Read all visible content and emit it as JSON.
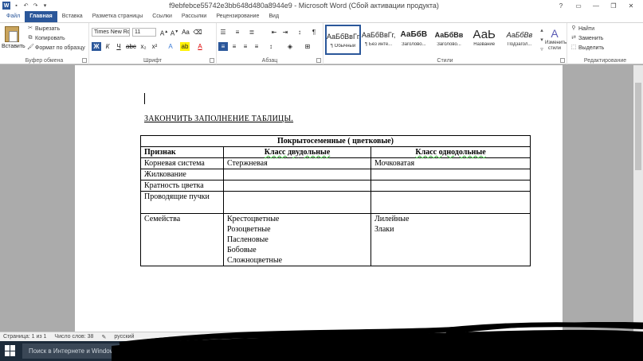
{
  "window": {
    "title": "f9ebfebce55742e3bb648d480a8944e9 - Microsoft Word (Сбой активации продукта)",
    "app_icon": "W"
  },
  "tabs": [
    {
      "label": "Файл"
    },
    {
      "label": "Главная",
      "active": true
    },
    {
      "label": "Вставка"
    },
    {
      "label": "Разметка страницы"
    },
    {
      "label": "Ссылки"
    },
    {
      "label": "Рассылки"
    },
    {
      "label": "Рецензирование"
    },
    {
      "label": "Вид"
    }
  ],
  "ribbon": {
    "clipboard": {
      "paste": "Вставить",
      "cut": "Вырезать",
      "copy": "Копировать",
      "format_painter": "Формат по образцу",
      "label": "Буфер обмена"
    },
    "font": {
      "name": "Times New Ro",
      "size": "11",
      "label": "Шрифт",
      "bold": "Ж",
      "italic": "К",
      "underline": "Ч"
    },
    "paragraph": {
      "label": "Абзац"
    },
    "styles": {
      "label": "Стили",
      "items": [
        {
          "preview": "АаБбВвГг,",
          "name": "¶ Обычный",
          "selected": true
        },
        {
          "preview": "АаБбВвГг,",
          "name": "¶ Без инте..."
        },
        {
          "preview": "АаБбВ",
          "name": "Заголово..."
        },
        {
          "preview": "АаБбВв",
          "name": "Заголово..."
        },
        {
          "preview": "АаЬ",
          "name": "Название"
        },
        {
          "preview": "АаБбВв",
          "name": "Подзагол..."
        }
      ],
      "change_styles": "Изменить стили"
    },
    "editing": {
      "find": "Найти",
      "replace": "Заменить",
      "select": "Выделить",
      "label": "Редактирование"
    }
  },
  "document": {
    "heading": "ЗАКОНЧИТЬ ЗАПОЛНЕНИЕ  ТАБЛИЦЫ.",
    "table": {
      "title": "Покрытосеменные ( цветковые)",
      "headers": [
        "Признак",
        "Класс двудольные",
        "Класс однодольные"
      ],
      "rows": [
        {
          "feature": "Корневая система",
          "dicot": [
            "Стержневая"
          ],
          "monocot": [
            "Мочковатая"
          ]
        },
        {
          "feature": "Жилкование",
          "dicot": [],
          "monocot": []
        },
        {
          "feature": "Кратность цветка",
          "dicot": [],
          "monocot": []
        },
        {
          "feature": "Проводящие пучки",
          "dicot": [],
          "monocot": []
        },
        {
          "feature": "Семейства",
          "dicot": [
            "Крестоцветные",
            "Розоцветные",
            "Пасленовые",
            "Бобовые",
            "Сложноцветные"
          ],
          "monocot": [
            "Лилейные",
            "Злаки"
          ]
        }
      ]
    }
  },
  "statusbar": {
    "page": "Страница: 1 из 1",
    "words": "Число слов: 38",
    "language": "русский"
  },
  "taskbar": {
    "search_placeholder": "Поиск в Интернете и Windows"
  }
}
